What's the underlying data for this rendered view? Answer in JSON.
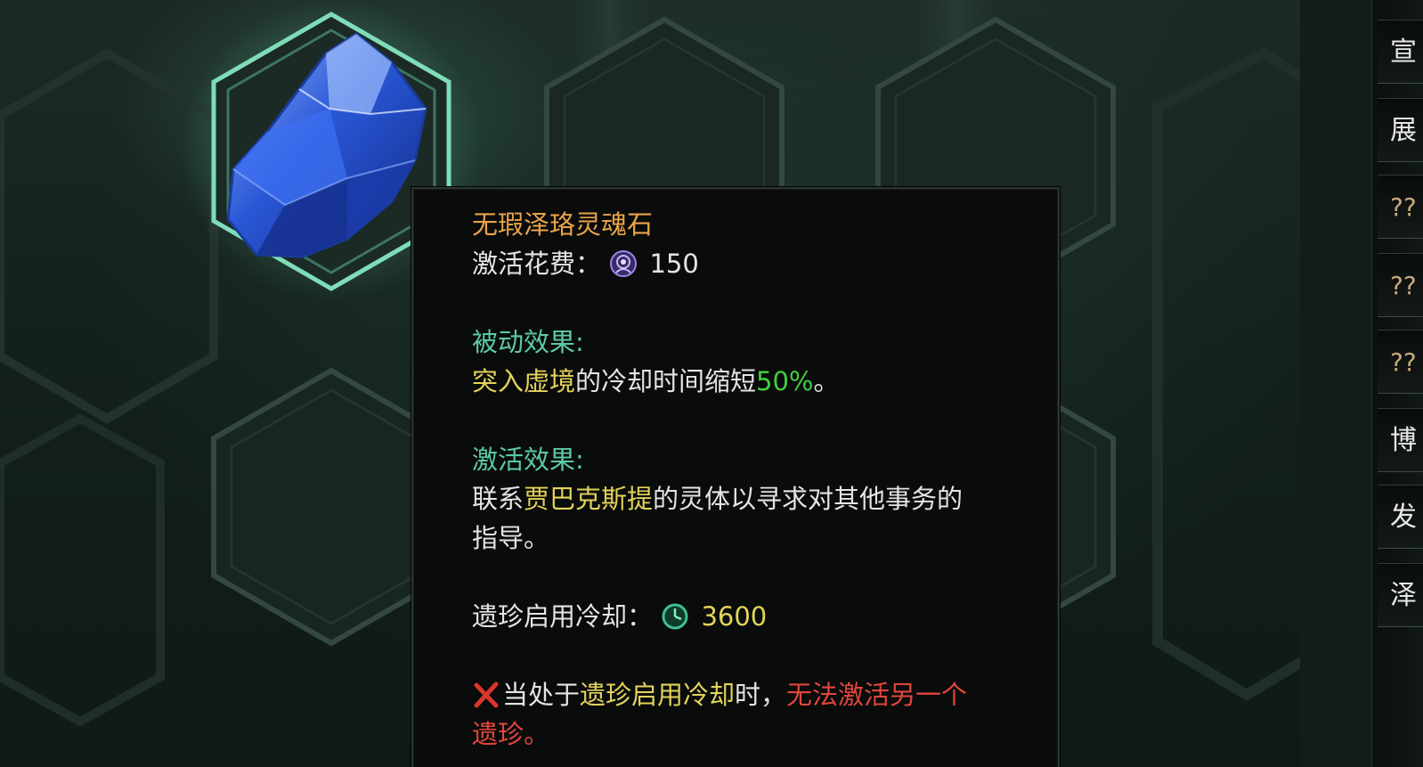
{
  "tooltip": {
    "item_name": "无瑕泽珞灵魂石",
    "activation_cost_label": "激活花费：",
    "activation_cost_icon": "soul-currency-icon",
    "activation_cost_value": "150",
    "passive_header": "被动效果:",
    "passive_highlight": "突入虚境",
    "passive_text": "的冷却时间缩短",
    "passive_percent": "50%",
    "passive_end": "。",
    "active_header": "激活效果:",
    "active_prefix": "联系",
    "active_highlight": "贾巴克斯提",
    "active_text_1": "的灵体以寻求对其他事务的",
    "active_text_2": "指导。",
    "cooldown_label": "遗珍启用冷却：",
    "cooldown_icon": "clock-icon",
    "cooldown_value": "3600",
    "warning_icon": "red-x-icon",
    "warning_prefix": "当处于",
    "warning_highlight": "遗珍启用冷却",
    "warning_mid": "时，",
    "warning_red_1": "无法激活另一个",
    "warning_red_2": "遗珍。"
  },
  "side_menu": {
    "items": [
      {
        "label": "宣"
      },
      {
        "label": "展"
      },
      {
        "label": "??"
      },
      {
        "label": "??"
      },
      {
        "label": "??"
      },
      {
        "label": "博"
      },
      {
        "label": "发"
      },
      {
        "label": "泽"
      }
    ]
  },
  "colors": {
    "item_name": "#e8a44a",
    "section_header": "#5cc9a8",
    "highlight": "#e2d35a",
    "percent": "#3fcf3f",
    "warning": "#e0463c"
  }
}
